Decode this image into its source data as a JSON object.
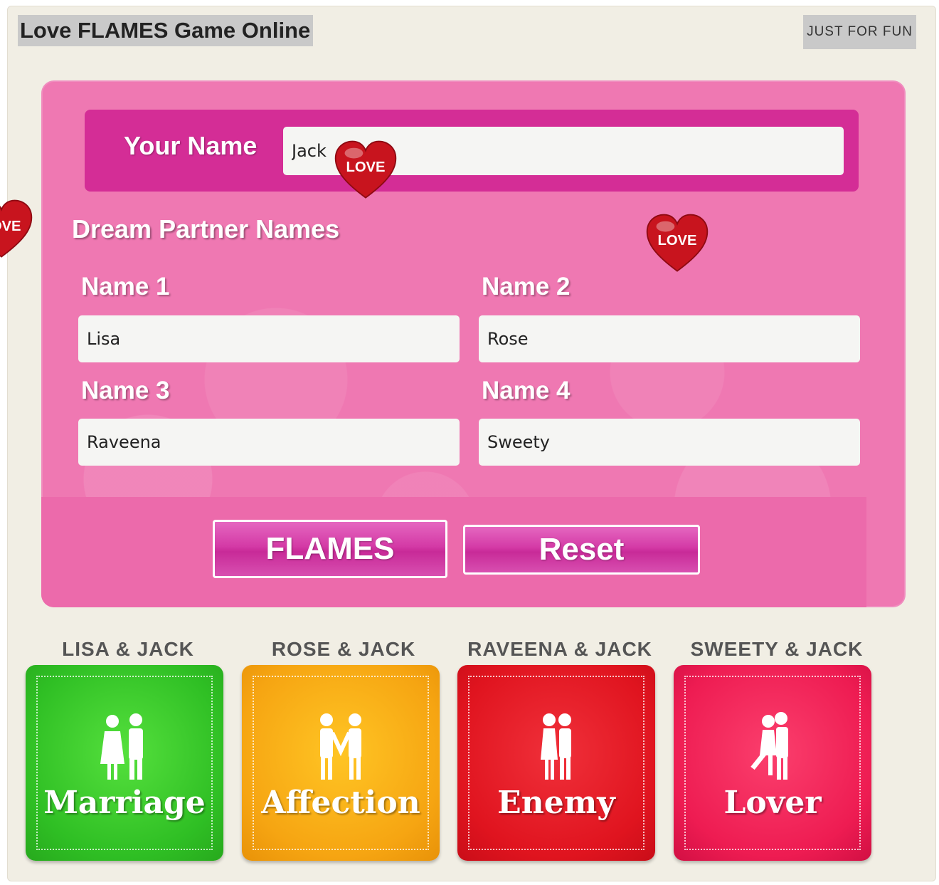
{
  "header": {
    "title": "Love FLAMES Game Online",
    "badge": "JUST FOR FUN"
  },
  "form": {
    "your_name_label": "Your Name",
    "your_name_value": "Jack",
    "dream_heading": "Dream Partner Names",
    "partners": [
      {
        "label": "Name 1",
        "value": "Lisa"
      },
      {
        "label": "Name 2",
        "value": "Rose"
      },
      {
        "label": "Name 3",
        "value": "Raveena"
      },
      {
        "label": "Name 4",
        "value": "Sweety"
      }
    ],
    "flames_button": "FLAMES",
    "reset_button": "Reset"
  },
  "decorations": {
    "heart_text": "LOVE",
    "heart_color": "#c8141e"
  },
  "results": [
    {
      "pair": "LISA & JACK",
      "result": "Marriage",
      "color": "#33c428",
      "icon": "couple-marriage-icon"
    },
    {
      "pair": "ROSE & JACK",
      "result": "Affection",
      "color": "#f8a814",
      "icon": "couple-holding-hands-icon"
    },
    {
      "pair": "RAVEENA & JACK",
      "result": "Enemy",
      "color": "#e3141f",
      "icon": "couple-back-to-back-icon"
    },
    {
      "pair": "SWEETY & JACK",
      "result": "Lover",
      "color": "#ef1f54",
      "icon": "couple-kissing-icon"
    }
  ]
}
